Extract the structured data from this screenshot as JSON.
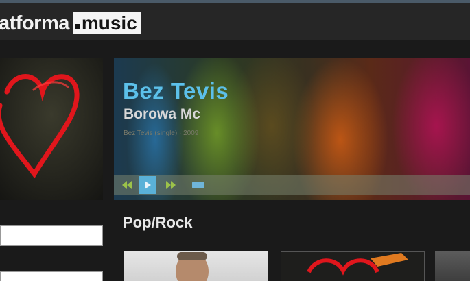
{
  "header": {
    "logo_text": "atforma",
    "logo_box_text": "music"
  },
  "now_playing": {
    "title": "Bez Tevis",
    "artist": "Borowa Mc",
    "meta": "Bez Tevis (single) · 2009",
    "controls": {
      "prev_icon": "skip-back-icon",
      "play_icon": "play-icon",
      "next_icon": "skip-forward-icon",
      "volume_icon": "volume-icon"
    }
  },
  "section": {
    "heading": "Pop/Rock"
  },
  "colors": {
    "accent": "#5cc0ea",
    "background": "#1a1a1a",
    "header": "#262626",
    "heart": "#e0161c"
  }
}
